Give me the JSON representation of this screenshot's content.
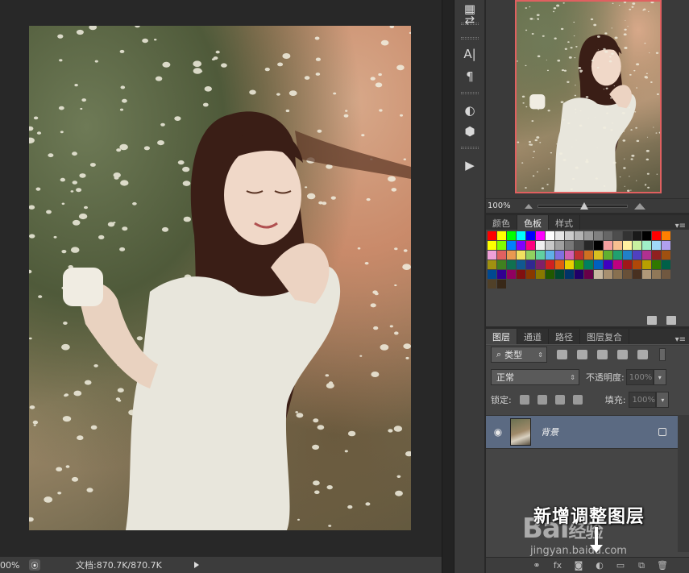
{
  "status_bar": {
    "zoom": "00%",
    "doc_info": "文档:870.7K/870.7K"
  },
  "tool_strip": {
    "icons": [
      "ruler-icon",
      "history-icon",
      "character-icon",
      "paragraph-icon",
      "adjustment-icon",
      "3d-icon",
      "play-icon"
    ],
    "char_glyph": "A|",
    "para_glyph": "¶"
  },
  "navigator": {
    "zoom": "100%"
  },
  "swatch_tabs": [
    {
      "label": "颜色",
      "active": false
    },
    {
      "label": "色板",
      "active": true
    },
    {
      "label": "样式",
      "active": false
    }
  ],
  "swatches": [
    "#ff0000",
    "#ffff00",
    "#00ff00",
    "#00ffff",
    "#0000ff",
    "#ff00ff",
    "#ffffff",
    "#e6e6e6",
    "#cccccc",
    "#b3b3b3",
    "#999999",
    "#808080",
    "#666666",
    "#4d4d4d",
    "#333333",
    "#1a1a1a",
    "#000000",
    "#ff0000",
    "#ff7f00",
    "#ffff00",
    "#80ff00",
    "#0080ff",
    "#8000ff",
    "#ff0080",
    "#f0f0f0",
    "#c8c8c8",
    "#a0a0a0",
    "#787878",
    "#505050",
    "#282828",
    "#000000",
    "#f4a0a0",
    "#f8c090",
    "#fff0a0",
    "#c8f0a0",
    "#a0f0c8",
    "#a0d8f8",
    "#b0a0f0",
    "#f0a0d8",
    "#e06060",
    "#e89850",
    "#f0e060",
    "#90d060",
    "#60d0a0",
    "#60b0e8",
    "#8070e0",
    "#d060b0",
    "#c03030",
    "#d07020",
    "#d8c020",
    "#60b030",
    "#20a070",
    "#2080c8",
    "#5040c0",
    "#b03090",
    "#902020",
    "#a05010",
    "#a09010",
    "#408020",
    "#107050",
    "#105890",
    "#302890",
    "#802068",
    "#d02020",
    "#e06010",
    "#e8d000",
    "#40a000",
    "#008060",
    "#0060c0",
    "#4000c0",
    "#c00080",
    "#a01818",
    "#b04808",
    "#b8a000",
    "#307800",
    "#006048",
    "#004890",
    "#300090",
    "#900060",
    "#801010",
    "#883800",
    "#887800",
    "#205800",
    "#004830",
    "#003468",
    "#200068",
    "#680048",
    "#c8b8a0",
    "#a89070",
    "#887050",
    "#685038",
    "#483020",
    "#b09878",
    "#907858",
    "#705840",
    "#504028",
    "#382818"
  ],
  "layer_tabs": [
    {
      "label": "图层",
      "active": true
    },
    {
      "label": "通道",
      "active": false
    },
    {
      "label": "路径",
      "active": false
    },
    {
      "label": "图层复合",
      "active": false
    }
  ],
  "layers_panel": {
    "filter_label": "类型",
    "blend_mode": "正常",
    "opacity_label": "不透明度:",
    "opacity_value": "100%",
    "lock_label": "锁定:",
    "fill_label": "填充:",
    "fill_value": "100%",
    "layer_name": "背景"
  },
  "annotation": {
    "text": "新增调整图层"
  },
  "watermark": {
    "logo": "Bai",
    "logo_suffix": "经验",
    "url": "jingyan.baidu.com"
  },
  "colors": {
    "layer_selected": "#5b6a82",
    "nav_border": "#e06060",
    "panel_bg": "#454545"
  }
}
